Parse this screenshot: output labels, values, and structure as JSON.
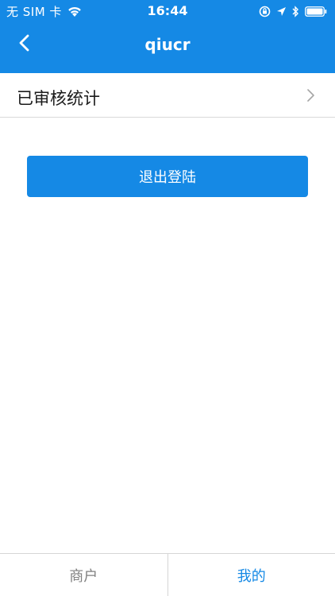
{
  "status_bar": {
    "carrier": "无 SIM 卡",
    "time": "16:44"
  },
  "nav": {
    "title": "qiucr"
  },
  "list": {
    "items": [
      {
        "label": "已审核统计"
      }
    ]
  },
  "actions": {
    "logout_label": "退出登陆"
  },
  "tabs": [
    {
      "label": "商户",
      "active": false
    },
    {
      "label": "我的",
      "active": true
    }
  ],
  "colors": {
    "primary": "#1589E5",
    "tab_inactive": "#808080",
    "text": "#1a1a1a"
  },
  "icons": {
    "back": "chevron-left-icon",
    "row_arrow": "chevron-right-icon",
    "wifi": "wifi-icon",
    "orientation_lock": "orientation-lock-icon",
    "location": "location-arrow-icon",
    "bluetooth": "bluetooth-icon",
    "battery": "battery-icon"
  }
}
